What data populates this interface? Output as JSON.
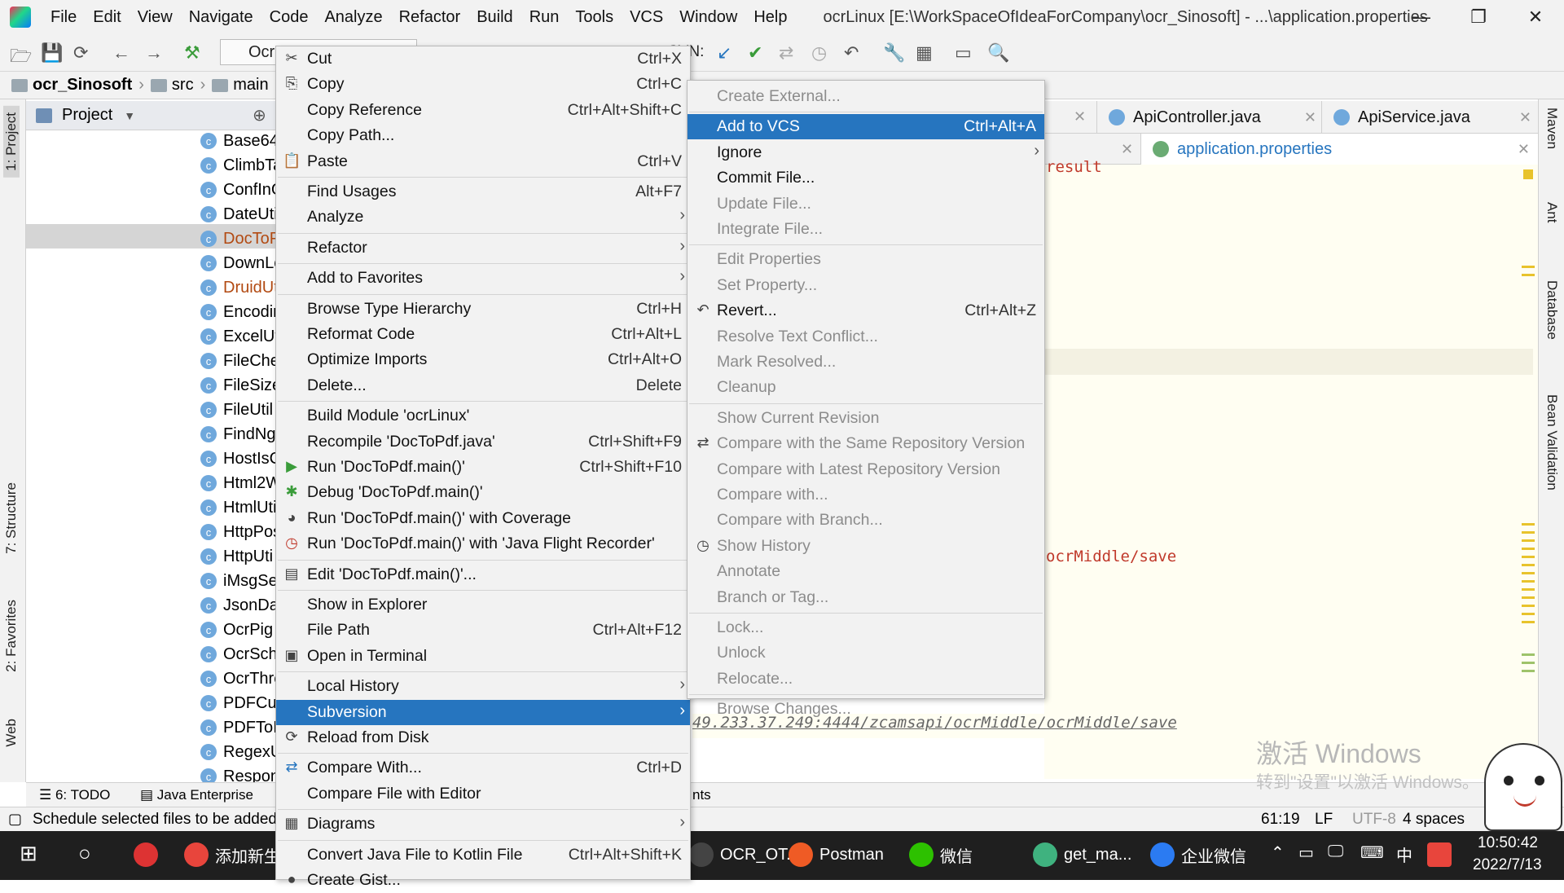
{
  "app": {
    "menus": [
      "File",
      "Edit",
      "View",
      "Navigate",
      "Code",
      "Analyze",
      "Refactor",
      "Build",
      "Run",
      "Tools",
      "VCS",
      "Window",
      "Help"
    ],
    "title": "ocrLinux [E:\\WorkSpaceOfIdeaForCompany\\ocr_Sinosoft] - ...\\application.properties"
  },
  "window_controls": [
    "—",
    "❐",
    "✕"
  ],
  "toolbar": {
    "run_config": "OcrL",
    "svn_label": "SVN:"
  },
  "breadcrumb": [
    "ocr_Sinosoft",
    "src",
    "main"
  ],
  "left_tabs": [
    "1: Project",
    "7: Structure",
    "2: Favorites",
    "Web"
  ],
  "right_tabs": [
    "Maven",
    "Ant",
    "Database",
    "Bean Validation"
  ],
  "project_panel": {
    "title": "Project",
    "items": [
      {
        "label": "Base64U",
        "red": false
      },
      {
        "label": "ClimbTa",
        "red": false
      },
      {
        "label": "ConfInG",
        "red": false
      },
      {
        "label": "DateUti",
        "red": false
      },
      {
        "label": "DocToP",
        "red": true
      },
      {
        "label": "DownLo",
        "red": false
      },
      {
        "label": "DruidUt",
        "red": true
      },
      {
        "label": "Encodin",
        "red": false
      },
      {
        "label": "ExcelUti",
        "red": false
      },
      {
        "label": "FileChe",
        "red": false
      },
      {
        "label": "FileSize",
        "red": false
      },
      {
        "label": "FileUtil",
        "red": false
      },
      {
        "label": "FindNg",
        "red": false
      },
      {
        "label": "HostIsC",
        "red": false
      },
      {
        "label": "Html2W",
        "red": false
      },
      {
        "label": "HtmlUti",
        "red": false
      },
      {
        "label": "HttpPos",
        "red": false
      },
      {
        "label": "HttpUti",
        "red": false
      },
      {
        "label": "iMsgSer",
        "red": false
      },
      {
        "label": "JsonDat",
        "red": false
      },
      {
        "label": "OcrPig",
        "red": false
      },
      {
        "label": "OcrSche",
        "red": false
      },
      {
        "label": "OcrThre",
        "red": false
      },
      {
        "label": "PDFCut",
        "red": false
      },
      {
        "label": "PDFToI",
        "red": false
      },
      {
        "label": "RegexU",
        "red": false
      },
      {
        "label": "Respon",
        "red": false
      }
    ]
  },
  "editor_tabs": {
    "row1": [
      "ApiController.java",
      "ApiService.java"
    ],
    "row2": [
      "application.properties"
    ]
  },
  "editor_code": {
    "fragment_top": "result",
    "fragment_mid": "ocrMiddle/save",
    "fragment_url": "49.233.37.249:4444/zcamsapi/ocrMiddle/ocrMiddle/save"
  },
  "context_menu": [
    {
      "label": "Cut",
      "shortcut": "Ctrl+X",
      "icon": "✂",
      "dis": false
    },
    {
      "label": "Copy",
      "shortcut": "Ctrl+C",
      "icon": "⎘",
      "dis": false
    },
    {
      "label": "Copy Reference",
      "shortcut": "Ctrl+Alt+Shift+C",
      "icon": "",
      "dis": false
    },
    {
      "label": "Copy Path...",
      "shortcut": "",
      "icon": "",
      "dis": false
    },
    {
      "label": "Paste",
      "shortcut": "Ctrl+V",
      "icon": "📋",
      "dis": false
    },
    {
      "sep": true
    },
    {
      "label": "Find Usages",
      "shortcut": "Alt+F7",
      "icon": "",
      "dis": false
    },
    {
      "label": "Analyze",
      "submenu": true
    },
    {
      "sep": true
    },
    {
      "label": "Refactor",
      "submenu": true
    },
    {
      "sep": true
    },
    {
      "label": "Add to Favorites",
      "submenu": true
    },
    {
      "sep": true
    },
    {
      "label": "Browse Type Hierarchy",
      "shortcut": "Ctrl+H"
    },
    {
      "label": "Reformat Code",
      "shortcut": "Ctrl+Alt+L"
    },
    {
      "label": "Optimize Imports",
      "shortcut": "Ctrl+Alt+O"
    },
    {
      "label": "Delete...",
      "shortcut": "Delete"
    },
    {
      "sep": true
    },
    {
      "label": "Build Module 'ocrLinux'",
      "shortcut": ""
    },
    {
      "label": "Recompile 'DocToPdf.java'",
      "shortcut": "Ctrl+Shift+F9"
    },
    {
      "label": "Run 'DocToPdf.main()'",
      "shortcut": "Ctrl+Shift+F10",
      "icon": "▶",
      "iconColor": "#3a9c3a"
    },
    {
      "label": "Debug 'DocToPdf.main()'",
      "shortcut": "",
      "icon": "✱",
      "iconColor": "#3a9c3a"
    },
    {
      "label": "Run 'DocToPdf.main()' with Coverage",
      "shortcut": "",
      "icon": "◕"
    },
    {
      "label": "Run 'DocToPdf.main()' with 'Java Flight Recorder'",
      "shortcut": "",
      "icon": "◷",
      "iconColor": "#c0392b"
    },
    {
      "sep": true
    },
    {
      "label": "Edit 'DocToPdf.main()'...",
      "shortcut": "",
      "icon": "▤"
    },
    {
      "sep": true
    },
    {
      "label": "Show in Explorer",
      "shortcut": ""
    },
    {
      "label": "File Path",
      "shortcut": "Ctrl+Alt+F12"
    },
    {
      "label": "Open in Terminal",
      "shortcut": "",
      "icon": "▣"
    },
    {
      "sep": true
    },
    {
      "label": "Local History",
      "submenu": true
    },
    {
      "label": "Subversion",
      "submenu": true,
      "selected": true
    },
    {
      "label": "Reload from Disk",
      "shortcut": "",
      "icon": "⟳"
    },
    {
      "sep": true
    },
    {
      "label": "Compare With...",
      "shortcut": "Ctrl+D",
      "icon": "⇄",
      "iconColor": "#2675bf"
    },
    {
      "label": "Compare File with Editor",
      "shortcut": ""
    },
    {
      "sep": true
    },
    {
      "label": "Diagrams",
      "submenu": true,
      "icon": "▦"
    },
    {
      "sep": true
    },
    {
      "label": "Convert Java File to Kotlin File",
      "shortcut": "Ctrl+Alt+Shift+K"
    },
    {
      "label": "Create Gist...",
      "shortcut": "",
      "icon": "●"
    }
  ],
  "svn_menu": [
    {
      "label": "Create External...",
      "dis": true
    },
    {
      "sep": true
    },
    {
      "label": "Add to VCS",
      "shortcut": "Ctrl+Alt+A",
      "selected": true
    },
    {
      "label": "Ignore",
      "submenu": true
    },
    {
      "label": "Commit File..."
    },
    {
      "label": "Update File...",
      "dis": true
    },
    {
      "label": "Integrate File...",
      "dis": true
    },
    {
      "sep": true
    },
    {
      "label": "Edit Properties",
      "dis": true
    },
    {
      "label": "Set Property...",
      "dis": true
    },
    {
      "label": "Revert...",
      "shortcut": "Ctrl+Alt+Z",
      "icon": "↶"
    },
    {
      "label": "Resolve Text Conflict...",
      "dis": true
    },
    {
      "label": "Mark Resolved...",
      "dis": true
    },
    {
      "label": "Cleanup",
      "dis": true
    },
    {
      "sep": true
    },
    {
      "label": "Show Current Revision",
      "dis": true
    },
    {
      "label": "Compare with the Same Repository Version",
      "dis": true,
      "icon": "⇄"
    },
    {
      "label": "Compare with Latest Repository Version",
      "dis": true
    },
    {
      "label": "Compare with...",
      "dis": true
    },
    {
      "label": "Compare with Branch...",
      "dis": true
    },
    {
      "label": "Show History",
      "dis": true,
      "icon": "◷"
    },
    {
      "label": "Annotate",
      "dis": true
    },
    {
      "label": "Branch or Tag...",
      "dis": true
    },
    {
      "sep": true
    },
    {
      "label": "Lock...",
      "dis": true
    },
    {
      "label": "Unlock",
      "dis": true
    },
    {
      "label": "Relocate...",
      "dis": true
    },
    {
      "sep": true
    },
    {
      "label": "Browse Changes...",
      "dis": true
    }
  ],
  "bottom_tools": {
    "todo": "6: TODO",
    "je": "Java Enterprise",
    "ents": "nts"
  },
  "status": {
    "message": "Schedule selected files to be added",
    "pos": "61:19",
    "lf": "LF",
    "enc": "UTF-8",
    "indent": "4 spaces"
  },
  "watermark": {
    "line1": "激活 Windows",
    "line2": "转到\"设置\"以激活 Windows。"
  },
  "taskbar": {
    "apps": [
      {
        "label": "添加新生",
        "color": "#e8453c"
      },
      {
        "label": "OCR_OT...",
        "color": "#444"
      },
      {
        "label": "Postman",
        "color": "#ef5b25"
      },
      {
        "label": "微信",
        "color": "#2dc100"
      },
      {
        "label": "get_ma...",
        "color": "#3fb27f"
      },
      {
        "label": "企业微信",
        "color": "#2b7bf2"
      }
    ],
    "ime": "中",
    "time": "10:50:42",
    "date": "2022/7/13"
  }
}
